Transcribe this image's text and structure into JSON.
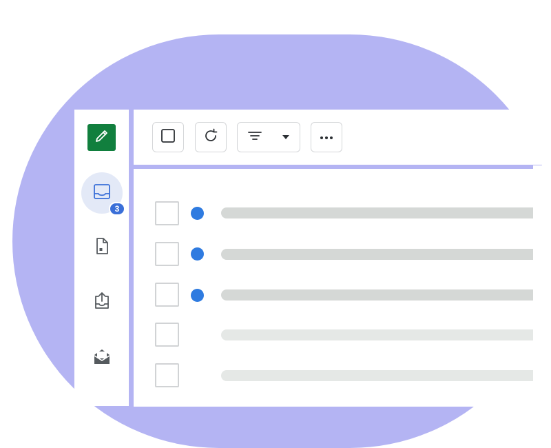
{
  "colors": {
    "background_blob": "#b4b4f3",
    "compose_green": "#117f3e",
    "unread_blue": "#2f7be0",
    "badge_blue": "#3a6fd8",
    "read_bar": "#d5d8d6",
    "dim_bar": "#e5e8e6"
  },
  "sidebar": {
    "items": [
      {
        "name": "compose",
        "icon": "pencil-icon"
      },
      {
        "name": "inbox",
        "icon": "inbox-tray-icon",
        "badge_count": "3",
        "active": true
      },
      {
        "name": "drafts",
        "icon": "document-icon"
      },
      {
        "name": "sent",
        "icon": "upload-tray-icon"
      },
      {
        "name": "archive",
        "icon": "open-envelope-icon"
      }
    ]
  },
  "toolbar": {
    "buttons": [
      {
        "name": "select-all",
        "icon": "checkbox-icon"
      },
      {
        "name": "refresh",
        "icon": "refresh-icon"
      },
      {
        "name": "filter",
        "icon": "filter-icon",
        "dropdown_icon": "caret-down-icon"
      },
      {
        "name": "more",
        "icon": "ellipsis-icon"
      }
    ]
  },
  "messages": [
    {
      "unread": true
    },
    {
      "unread": true
    },
    {
      "unread": true
    },
    {
      "unread": false
    },
    {
      "unread": false
    }
  ]
}
